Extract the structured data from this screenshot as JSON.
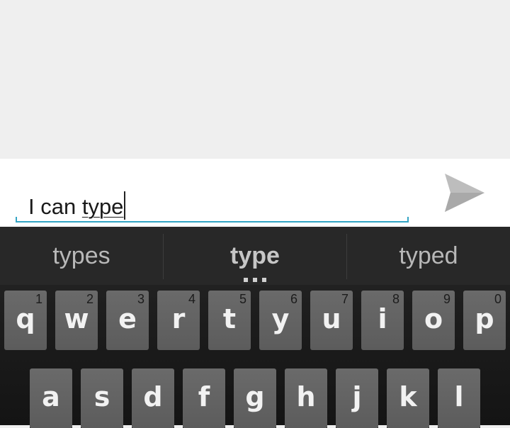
{
  "composer": {
    "typed_text": "I can ",
    "composing_word": "type",
    "send_icon": "send-icon"
  },
  "suggestions": [
    {
      "label": "types"
    },
    {
      "label": "type"
    },
    {
      "label": "typed"
    }
  ],
  "keyboard": {
    "row1": [
      {
        "label": "q",
        "hint": "1"
      },
      {
        "label": "w",
        "hint": "2"
      },
      {
        "label": "e",
        "hint": "3"
      },
      {
        "label": "r",
        "hint": "4"
      },
      {
        "label": "t",
        "hint": "5"
      },
      {
        "label": "y",
        "hint": "6"
      },
      {
        "label": "u",
        "hint": "7"
      },
      {
        "label": "i",
        "hint": "8"
      },
      {
        "label": "o",
        "hint": "9"
      },
      {
        "label": "p",
        "hint": "0"
      }
    ],
    "row2": [
      {
        "label": "a"
      },
      {
        "label": "s"
      },
      {
        "label": "d"
      },
      {
        "label": "f"
      },
      {
        "label": "g"
      },
      {
        "label": "h"
      },
      {
        "label": "j"
      },
      {
        "label": "k"
      },
      {
        "label": "l"
      }
    ]
  },
  "colors": {
    "accent": "#33a4c4",
    "key_face": "#646464",
    "keyboard_bg": "#1e1e1e"
  }
}
